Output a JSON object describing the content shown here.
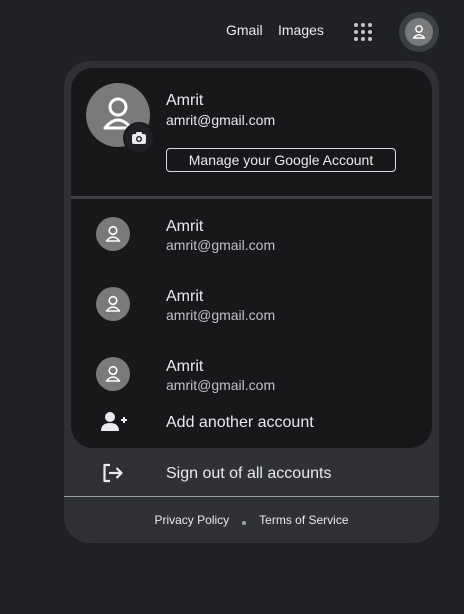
{
  "topbar": {
    "gmail_label": "Gmail",
    "images_label": "Images",
    "apps_icon": "apps-grid-icon",
    "avatar_icon": "person-icon"
  },
  "primary_account": {
    "name": "Amrit",
    "email": "amrit@gmail.com",
    "manage_label": "Manage your Google Account",
    "camera_icon": "camera-icon"
  },
  "other_accounts": [
    {
      "name": "Amrit",
      "email": "amrit@gmail.com"
    },
    {
      "name": "Amrit",
      "email": "amrit@gmail.com"
    },
    {
      "name": "Amrit",
      "email": "amrit@gmail.com"
    }
  ],
  "add_account": {
    "label": "Add another account",
    "icon": "person-add-icon"
  },
  "sign_out": {
    "label": "Sign out of all accounts",
    "icon": "logout-icon"
  },
  "footer": {
    "privacy_label": "Privacy Policy",
    "terms_label": "Terms of Service"
  },
  "colors": {
    "page_background": "#202124",
    "panel_background": "#303134",
    "card_background": "#18181a",
    "avatar_gray": "#7a7a7a",
    "text": "#e8eaed"
  }
}
